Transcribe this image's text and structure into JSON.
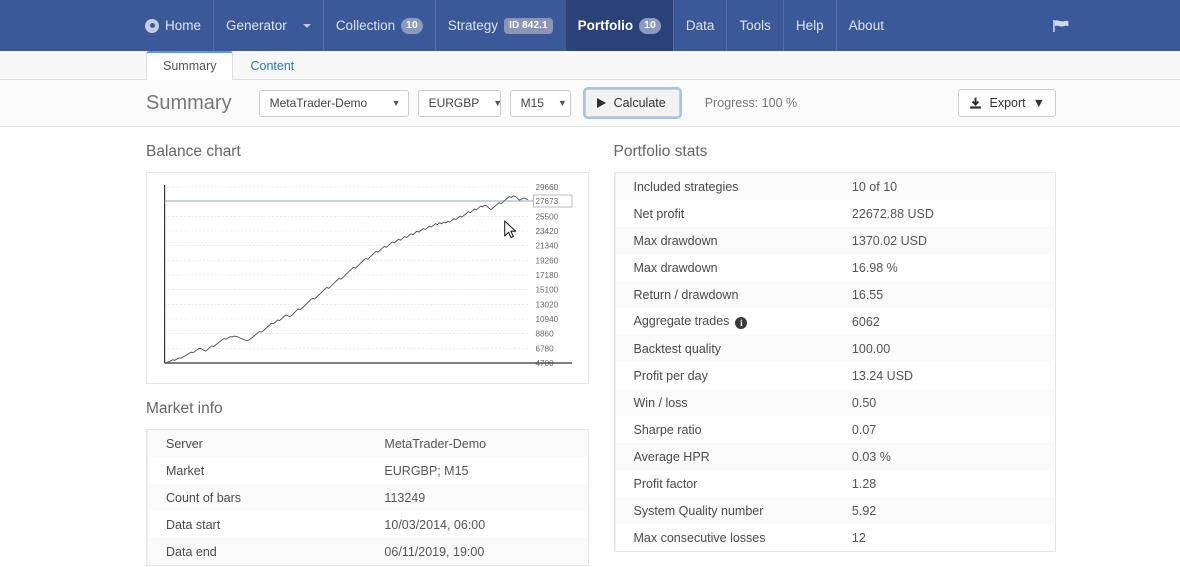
{
  "navbar": {
    "home_label": "Home",
    "items": [
      {
        "label": "Generator",
        "badge": null,
        "caret": true,
        "active": false
      },
      {
        "label": "Collection",
        "badge": "10",
        "caret": false,
        "active": false
      },
      {
        "label": "Strategy",
        "badge": "ID 842.1",
        "caret": false,
        "active": false
      },
      {
        "label": "Portfolio",
        "badge": "10",
        "caret": false,
        "active": true
      },
      {
        "label": "Data",
        "badge": null,
        "caret": false,
        "active": false
      },
      {
        "label": "Tools",
        "badge": null,
        "caret": false,
        "active": false
      },
      {
        "label": "Help",
        "badge": null,
        "caret": false,
        "active": false
      },
      {
        "label": "About",
        "badge": null,
        "caret": false,
        "active": false
      }
    ],
    "right_icon": "flag-icon",
    "bg_color": "#3b5998",
    "active_bg_color": "#2b4279"
  },
  "tabs": [
    {
      "label": "Summary",
      "active": true
    },
    {
      "label": "Content",
      "active": false
    }
  ],
  "toolbar": {
    "title": "Summary",
    "server_select": "MetaTrader-Demo",
    "symbol_select": "EURGBP",
    "timeframe_select": "M15",
    "calculate_label": "Calculate",
    "progress_label": "Progress: 100 %",
    "export_label": "Export"
  },
  "balance_chart": {
    "title": "Balance chart"
  },
  "chart_data": {
    "type": "line",
    "title": "Balance chart",
    "xlabel": "",
    "ylabel": "",
    "grid": true,
    "legend": "none",
    "ylim": [
      4700,
      29660
    ],
    "y_ticks": [
      29660,
      27673,
      25500,
      23420,
      21340,
      19260,
      17180,
      15100,
      13020,
      10940,
      8860,
      6780,
      4700
    ],
    "marker_value": 27673,
    "marker_line": true,
    "series": [
      {
        "name": "Balance",
        "values": [
          4700,
          4760,
          4880,
          5010,
          5150,
          5090,
          5260,
          5420,
          5380,
          5560,
          5710,
          5900,
          6080,
          6240,
          6180,
          6420,
          6610,
          6800,
          6700,
          6520,
          6380,
          6610,
          6890,
          7120,
          7050,
          7290,
          7520,
          7760,
          7980,
          8150,
          8080,
          8260,
          8430,
          8390,
          8510,
          8470,
          8350,
          8210,
          8090,
          7980,
          7860,
          7940,
          8150,
          8390,
          8620,
          8880,
          9140,
          9080,
          9260,
          9520,
          9800,
          10050,
          10320,
          10280,
          10480,
          10790,
          10720,
          10960,
          11240,
          11500,
          11420,
          11280,
          11460,
          11740,
          12060,
          12380,
          12250,
          12480,
          12760,
          13050,
          13330,
          13620,
          13890,
          13760,
          14020,
          14310,
          14580,
          14860,
          15140,
          15420,
          15290,
          15570,
          15860,
          16140,
          16420,
          16700,
          16580,
          16860,
          17150,
          17440,
          17720,
          17990,
          18270,
          18130,
          18420,
          18700,
          18990,
          19270,
          19550,
          19410,
          19700,
          19980,
          20260,
          20540,
          20420,
          20690,
          20960,
          21230,
          21100,
          21360,
          21620,
          21880,
          21740,
          21990,
          22240,
          22120,
          22380,
          22640,
          22500,
          22760,
          23020,
          22890,
          23140,
          23380,
          23260,
          23510,
          23760,
          23630,
          23870,
          24110,
          23980,
          24220,
          24460,
          24330,
          24570,
          24440,
          24680,
          24560,
          24800,
          24680,
          24920,
          25160,
          25040,
          25290,
          25530,
          25400,
          25650,
          25900,
          26150,
          26020,
          26280,
          26540,
          26420,
          26690,
          26960,
          26830,
          27100,
          26960,
          26700,
          26440,
          26680,
          26930,
          27180,
          27430,
          27300,
          27560,
          27820,
          28060,
          28290,
          28170,
          28420,
          28300,
          28050,
          27800,
          27960,
          28120,
          27990,
          27873
        ]
      }
    ]
  },
  "market_info": {
    "title": "Market info",
    "rows": [
      {
        "key": "Server",
        "value": "MetaTrader-Demo"
      },
      {
        "key": "Market",
        "value": "EURGBP; M15"
      },
      {
        "key": "Count of bars",
        "value": "113249"
      },
      {
        "key": "Data start",
        "value": "10/03/2014, 06:00"
      },
      {
        "key": "Data end",
        "value": "06/11/2019, 19:00"
      }
    ]
  },
  "portfolio_stats": {
    "title": "Portfolio stats",
    "rows": [
      {
        "key": "Included strategies",
        "value": "10 of 10",
        "info": false
      },
      {
        "key": "Net profit",
        "value": "22672.88 USD",
        "info": false
      },
      {
        "key": "Max drawdown",
        "value": "1370.02 USD",
        "info": false
      },
      {
        "key": "Max drawdown",
        "value": "16.98 %",
        "info": false
      },
      {
        "key": "Return / drawdown",
        "value": "16.55",
        "info": false
      },
      {
        "key": "Aggregate trades",
        "value": "6062",
        "info": true
      },
      {
        "key": "Backtest quality",
        "value": "100.00",
        "info": false
      },
      {
        "key": "Profit per day",
        "value": "13.24 USD",
        "info": false
      },
      {
        "key": "Win / loss",
        "value": "0.50",
        "info": false
      },
      {
        "key": "Sharpe ratio",
        "value": "0.07",
        "info": false
      },
      {
        "key": "Average HPR",
        "value": "0.03 %",
        "info": false
      },
      {
        "key": "Profit factor",
        "value": "1.28",
        "info": false
      },
      {
        "key": "System Quality number",
        "value": "5.92",
        "info": false
      },
      {
        "key": "Max consecutive losses",
        "value": "12",
        "info": false
      }
    ]
  }
}
